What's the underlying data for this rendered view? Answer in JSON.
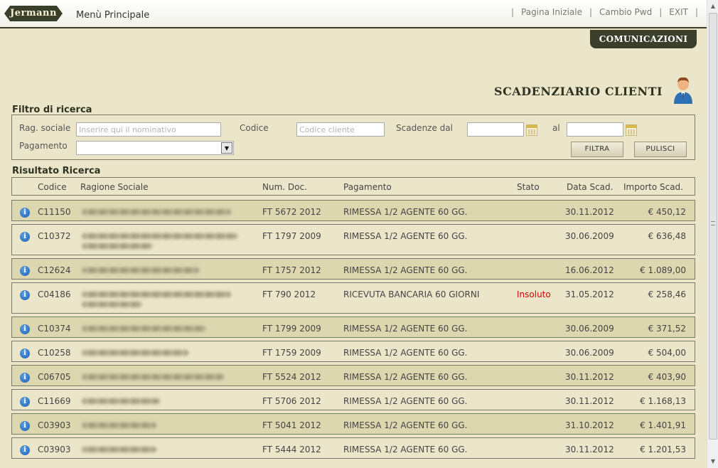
{
  "header": {
    "logo_text": "Jermann",
    "menu_title": "Menù Principale",
    "links": [
      "Pagina Iniziale",
      "Cambio Pwd",
      "EXIT"
    ]
  },
  "comm_tab": "COMUNICAZIONI",
  "page_title": "SCADENZIARIO CLIENTI",
  "filter": {
    "title": "Filtro di ricerca",
    "rag_label": "Rag. sociale",
    "rag_placeholder": "Inserire qui il nominativo",
    "codice_label": "Codice",
    "codice_placeholder": "Codice cliente",
    "scadenze_label": "Scadenze dal",
    "al_label": "al",
    "pagamento_label": "Pagamento",
    "filtra_label": "FILTRA",
    "pulisci_label": "PULISCI"
  },
  "results": {
    "title": "Risultato Ricerca",
    "columns": [
      "Codice",
      "Ragione Sociale",
      "Num. Doc.",
      "Pagamento",
      "Stato",
      "Data Scad.",
      "Importo Scad."
    ],
    "rows": [
      {
        "codice": "C11150",
        "num_doc": "FT 5672 2012",
        "pagamento": "RIMESSA 1/2 AGENTE 60 GG.",
        "stato": "",
        "data": "30.11.2012",
        "importo": "€ 450,12"
      },
      {
        "codice": "C10372",
        "num_doc": "FT 1797 2009",
        "pagamento": "RIMESSA 1/2 AGENTE 60 GG.",
        "stato": "",
        "data": "30.06.2009",
        "importo": "€ 636,48"
      },
      {
        "codice": "C12624",
        "num_doc": "FT 1757 2012",
        "pagamento": "RIMESSA 1/2 AGENTE 60 GG.",
        "stato": "",
        "data": "16.06.2012",
        "importo": "€ 1.089,00"
      },
      {
        "codice": "C04186",
        "num_doc": "FT 790 2012",
        "pagamento": "RICEVUTA BANCARIA 60 GIORNI",
        "stato": "Insoluto",
        "data": "31.05.2012",
        "importo": "€ 258,46"
      },
      {
        "codice": "C10374",
        "num_doc": "FT 1799 2009",
        "pagamento": "RIMESSA 1/2 AGENTE 60 GG.",
        "stato": "",
        "data": "30.06.2009",
        "importo": "€ 371,52"
      },
      {
        "codice": "C10258",
        "num_doc": "FT 1759 2009",
        "pagamento": "RIMESSA 1/2 AGENTE 60 GG.",
        "stato": "",
        "data": "30.06.2009",
        "importo": "€ 504,00"
      },
      {
        "codice": "C06705",
        "num_doc": "FT 5524 2012",
        "pagamento": "RIMESSA 1/2 AGENTE 60 GG.",
        "stato": "",
        "data": "30.11.2012",
        "importo": "€ 403,90"
      },
      {
        "codice": "C11669",
        "num_doc": "FT 5706 2012",
        "pagamento": "RIMESSA 1/2 AGENTE 60 GG.",
        "stato": "",
        "data": "30.11.2012",
        "importo": "€ 1.168,13"
      },
      {
        "codice": "C03903",
        "num_doc": "FT 5041 2012",
        "pagamento": "RIMESSA 1/2 AGENTE 60 GG.",
        "stato": "",
        "data": "31.10.2012",
        "importo": "€ 1.401,91"
      },
      {
        "codice": "C03903",
        "num_doc": "FT 5444 2012",
        "pagamento": "RIMESSA 1/2 AGENTE 60 GG.",
        "stato": "",
        "data": "30.11.2012",
        "importo": "€ 1.201,53"
      }
    ]
  },
  "colors": {
    "header_dark": "#3a3f2b",
    "background": "#ebe6c9",
    "row_alt": "#ddd7b0",
    "insoluto": "#d40000",
    "info_icon": "#1c5fb3"
  }
}
